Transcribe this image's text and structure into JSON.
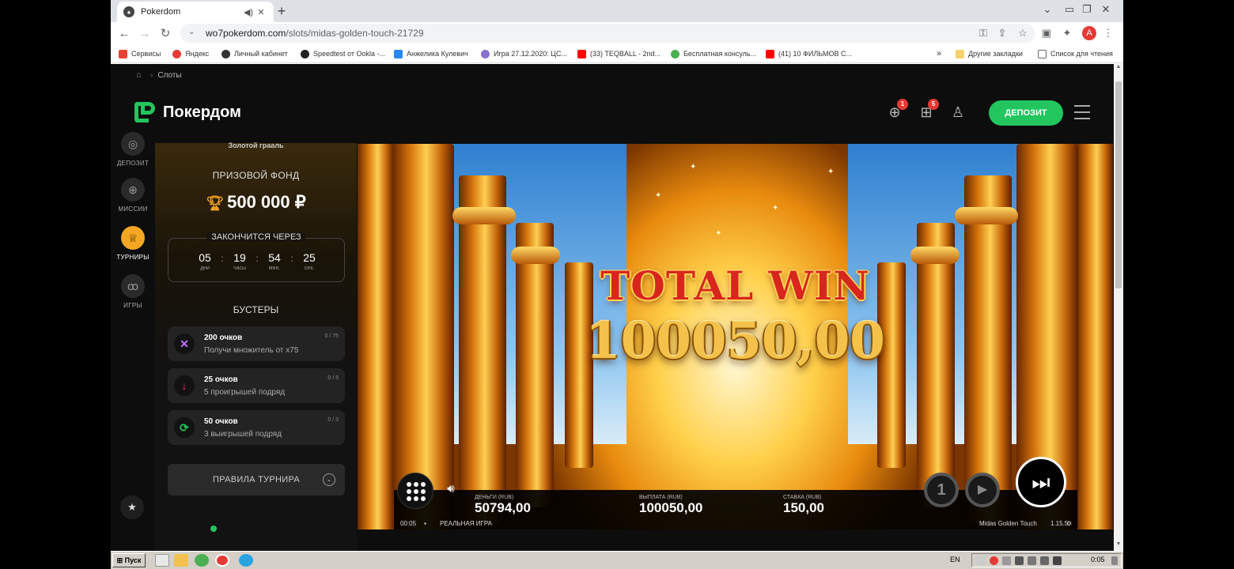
{
  "browser": {
    "tab_title": "Pokerdom",
    "url_host": "wo7pokerdom.com",
    "url_path": "/slots/midas-golden-touch-21729",
    "profile_initial": "A",
    "bookmarks": [
      {
        "label": "Сервисы",
        "color": "#e94235"
      },
      {
        "label": "Яндекс",
        "color": "#e53935"
      },
      {
        "label": "Личный кабинет",
        "color": "#333333"
      },
      {
        "label": "Speedtest от Ookla -...",
        "color": "#222222"
      },
      {
        "label": "Анжелика Кулевич",
        "color": "#2787f5"
      },
      {
        "label": "Игра 27.12.2020: ЦС...",
        "color": "#8a6fd1"
      },
      {
        "label": "(33) TEQBALL - 2nd...",
        "color": "#ff0000"
      },
      {
        "label": "Бесплатная консуль...",
        "color": "#4caf50"
      },
      {
        "label": "(41) 10 ФИЛЬМОВ С...",
        "color": "#ff0000"
      }
    ],
    "bookmarks_more": "»",
    "other_bookmarks": "Другие закладки",
    "reading_list": "Список для чтения"
  },
  "site": {
    "breadcrumb": "Слоты",
    "logo_text": "Покердом",
    "missions_badge": "1",
    "gifts_badge": "5",
    "deposit_label": "ДЕПОЗИТ"
  },
  "leftnav": {
    "items": [
      {
        "label": "ДЕПОЗИТ"
      },
      {
        "label": "МИССИИ"
      },
      {
        "label": "ТУРНИРЫ"
      },
      {
        "label": "ИГРЫ"
      }
    ]
  },
  "tournament": {
    "name": "Золотой грааль",
    "prize_label": "ПРИЗОВОЙ ФОНД",
    "prize_value": "500 000 ₽",
    "ends_label": "ЗАКОНЧИТСЯ ЧЕРЕЗ",
    "countdown": [
      {
        "num": "05",
        "unit": "дни"
      },
      {
        "num": "19",
        "unit": "часы"
      },
      {
        "num": "54",
        "unit": "мин."
      },
      {
        "num": "25",
        "unit": "сек."
      }
    ],
    "boosters_label": "БУСТЕРЫ",
    "boosters": [
      {
        "points": "200 очков",
        "desc": "Получи множитель от x75",
        "progress": "0 / 75",
        "icon": "✕",
        "color": "#c070ff"
      },
      {
        "points": "25 очков",
        "desc": "5 проигрышей подряд",
        "progress": "0 / 5",
        "icon": "↓",
        "color": "#ff2d55"
      },
      {
        "points": "50 очков",
        "desc": "3 выигрышей подряд",
        "progress": "0 / 3",
        "icon": "⟳",
        "color": "#22c55e"
      }
    ],
    "rules_label": "ПРАВИЛА ТУРНИРА"
  },
  "game": {
    "win_title": "TOTAL WIN",
    "win_amount": "100050,00",
    "money_label": "ДЕНЬГИ (RUB)",
    "money_value": "50794,00",
    "payout_label": "ВЫПЛАТА (RUB)",
    "payout_value": "100050,00",
    "bet_label": "СТАВКА (RUB)",
    "bet_value": "150,00",
    "timer": "00:05",
    "mode": "РЕАЛЬНАЯ ИГРА",
    "game_name": "Midas Golden Touch",
    "version": "1.15.5",
    "autoplay_icon": "1"
  },
  "taskbar": {
    "start_label": "Пуск",
    "lang": "EN",
    "clock": "0:05"
  }
}
